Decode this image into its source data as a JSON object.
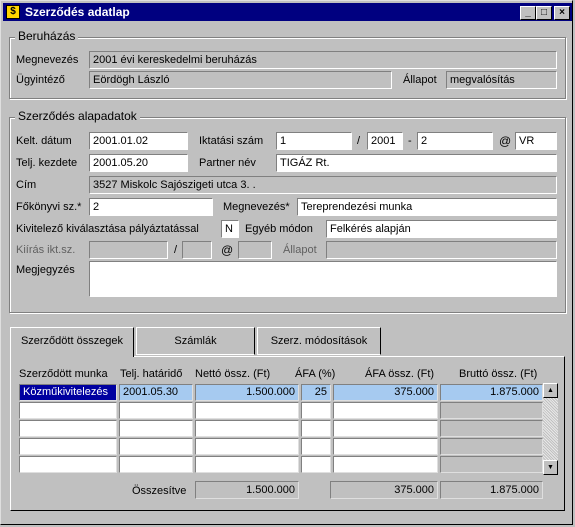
{
  "window": {
    "title": "Szerződés adatlap",
    "controls": {
      "minimize": "_",
      "maximize": "□",
      "close": "×"
    }
  },
  "beruhazas": {
    "group_title": "Beruházás",
    "megnevezes_label": "Megnevezés",
    "megnevezes_value": "2001 évi kereskedelmi beruházás",
    "ugyintezo_label": "Ügyintéző",
    "ugyintezo_value": "Eördögh László",
    "allapot_label": "Állapot",
    "allapot_value": "megvalósítás"
  },
  "alapadatok": {
    "group_title": "Szerződés alapadatok",
    "kelt_label": "Kelt. dátum",
    "kelt_value": "2001.01.02",
    "iktatasi_label": "Iktatási szám",
    "iktatasi_1": "1",
    "sep_slash": "/",
    "iktatasi_2": "2001",
    "sep_dash": "-",
    "iktatasi_3": "2",
    "sep_at": "@",
    "iktatasi_4": "VR",
    "telj_label": "Telj. kezdete",
    "telj_value": "2001.05.20",
    "partner_label": "Partner név",
    "partner_value": "TIGÁZ Rt.",
    "cim_label": "Cím",
    "cim_value": "3527 Miskolc Sajószigeti utca 3. .",
    "fokonyv_label": "Főkönyvi sz.*",
    "fokonyv_value": "2",
    "megnevezes_label": "Megnevezés*",
    "megnevezes_value": "Tereprendezési munka",
    "kivitelezo_label": "Kivitelező kiválasztása pályáztatással",
    "kivitelezo_value": "N",
    "egyeb_label": "Egyéb módon",
    "egyeb_value": "Felkérés alapján",
    "kiiras_label": "Kiírás ikt.sz.",
    "kiiras_slash": "/",
    "kiiras_at": "@",
    "allapot2_label": "Állapot",
    "megjegyzes_label": "Megjegyzés"
  },
  "tabs": [
    {
      "label": "Szerződött összegek"
    },
    {
      "label": "Számlák"
    },
    {
      "label": "Szerz. módosítások"
    }
  ],
  "table": {
    "headers": [
      "Szerződött munka",
      "Telj. határidő",
      "Nettó össz. (Ft)",
      "ÁFA (%)",
      "ÁFA össz. (Ft)",
      "Bruttó össz. (Ft)"
    ],
    "rows": [
      [
        "Közműkivitelezés",
        "2001.05.30",
        "1.500.000",
        "25",
        "375.000",
        "1.875.000"
      ]
    ],
    "total_label": "Összesítve",
    "total_netto": "1.500.000",
    "total_afa": "375.000",
    "total_brutto": "1.875.000"
  },
  "colors": {
    "titlebar": "#000080",
    "face": "#c0c0c0",
    "selected_row": "#a6caf0"
  }
}
